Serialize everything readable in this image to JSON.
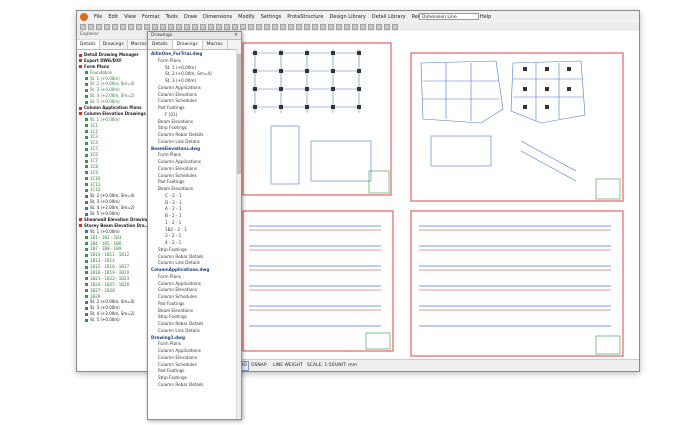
{
  "menu": [
    "File",
    "Edit",
    "View",
    "Format",
    "Tools",
    "Draw",
    "Dimensions",
    "Modify",
    "Settings",
    "ProtaStructure",
    "Design Library",
    "Detail Library",
    "Reinforcement",
    "Window",
    "Help"
  ],
  "combo_value": "Dimension Line",
  "left_panel": {
    "title": "Explorer",
    "tabs": [
      "Details",
      "Drawings",
      "Macros"
    ],
    "tree": [
      {
        "label": "Detail Drawing Manager",
        "style": "red bold"
      },
      {
        "label": "Export DWG/DXF",
        "style": "red bold"
      },
      {
        "label": "Form Plans",
        "style": "red bold"
      },
      {
        "label": "Foundation",
        "style": "green"
      },
      {
        "label": "St. 1 (+0.00m)",
        "style": "green"
      },
      {
        "label": "St. 2 (+0.00m, Sm=4)",
        "style": "green"
      },
      {
        "label": "St. 3 (+0.00m)",
        "style": "green"
      },
      {
        "label": "St. 4 (+2.00m, Sm=2)",
        "style": "green"
      },
      {
        "label": "St. 5 (+0.00m)",
        "style": "green"
      },
      {
        "label": "Column Application Plans",
        "style": "red bold"
      },
      {
        "label": "Column Elevation Drawings",
        "style": "red bold"
      },
      {
        "label": "St. 1 (+0.00m)",
        "style": "green"
      },
      {
        "label": "1C1",
        "style": "green"
      },
      {
        "label": "1C2",
        "style": "green"
      },
      {
        "label": "1C3",
        "style": "green"
      },
      {
        "label": "1C4",
        "style": "green"
      },
      {
        "label": "1C5",
        "style": "green"
      },
      {
        "label": "1C6",
        "style": "green"
      },
      {
        "label": "1C7",
        "style": "green"
      },
      {
        "label": "1C8",
        "style": "green"
      },
      {
        "label": "1C9",
        "style": "green"
      },
      {
        "label": "1C10",
        "style": "green"
      },
      {
        "label": "1C11",
        "style": "green"
      },
      {
        "label": "1C12",
        "style": "green"
      },
      {
        "label": "St. 2 (+0.00m, Sm=4)",
        "style": ""
      },
      {
        "label": "St. 3 (+0.00m)",
        "style": ""
      },
      {
        "label": "St. 4 (+2.00m, Sm=2)",
        "style": ""
      },
      {
        "label": "St. 5 (+0.00m)",
        "style": ""
      },
      {
        "label": "Shearwall Elevation Drawings",
        "style": "red bold"
      },
      {
        "label": "Storey Beam Elevation Dra...",
        "style": "red bold"
      },
      {
        "label": "St. 1 (+0.00m)",
        "style": ""
      },
      {
        "label": "1B1 - 1B2 - 1B3",
        "style": "green"
      },
      {
        "label": "1B4 - 1B5 - 1B6",
        "style": "green"
      },
      {
        "label": "1B7 - 1B8 - 1B9",
        "style": "green"
      },
      {
        "label": "1B10 - 1B11 - 1B12",
        "style": "green"
      },
      {
        "label": "1B13 - 1B14",
        "style": "green"
      },
      {
        "label": "1B15 - 1B16 - 1B17",
        "style": "green"
      },
      {
        "label": "1B18 - 1B19 - 1B20",
        "style": "green"
      },
      {
        "label": "1B21 - 1B22 - 1B23",
        "style": "green"
      },
      {
        "label": "1B24 - 1B25 - 1B26",
        "style": "green"
      },
      {
        "label": "1B27 - 1B28",
        "style": "green"
      },
      {
        "label": "1B29",
        "style": "green"
      },
      {
        "label": "St. 2 (+0.00m, Sm=4)",
        "style": ""
      },
      {
        "label": "St. 3 (+0.00m)",
        "style": ""
      },
      {
        "label": "St. 4 (+2.00m, Sm=2)",
        "style": ""
      },
      {
        "label": "St. 5 (+0.00m)",
        "style": ""
      }
    ]
  },
  "float_panel": {
    "title": "Drawings",
    "close": "×",
    "tabs": [
      "Details",
      "Drawings",
      "Macros"
    ],
    "items": [
      {
        "label": "AllInOne_ForTrial.dwg",
        "kind": "file",
        "indent": 0
      },
      {
        "label": "Form Plans",
        "kind": "",
        "indent": 1
      },
      {
        "label": "St. 1 (+0.00m)",
        "kind": "",
        "indent": 2
      },
      {
        "label": "St. 2 (+0.00m, Sm=4)",
        "kind": "",
        "indent": 2
      },
      {
        "label": "St. 3 (+0.00m)",
        "kind": "",
        "indent": 2
      },
      {
        "label": "Column Applications",
        "kind": "",
        "indent": 1
      },
      {
        "label": "Column Elevations",
        "kind": "",
        "indent": 1
      },
      {
        "label": "Column Schedules",
        "kind": "",
        "indent": 1
      },
      {
        "label": "Pad Footings",
        "kind": "",
        "indent": 1
      },
      {
        "label": "F (01)",
        "kind": "",
        "indent": 2
      },
      {
        "label": "Beam Elevations",
        "kind": "",
        "indent": 1
      },
      {
        "label": "Strip Footings",
        "kind": "",
        "indent": 1
      },
      {
        "label": "Column Rebar Details",
        "kind": "",
        "indent": 1
      },
      {
        "label": "Column Link Details",
        "kind": "",
        "indent": 1
      },
      {
        "label": "BeamElevations.dwg",
        "kind": "file",
        "indent": 0
      },
      {
        "label": "Form Plans",
        "kind": "",
        "indent": 1
      },
      {
        "label": "Column Applications",
        "kind": "",
        "indent": 1
      },
      {
        "label": "Column Elevations",
        "kind": "",
        "indent": 1
      },
      {
        "label": "Column Schedules",
        "kind": "",
        "indent": 1
      },
      {
        "label": "Pad Footings",
        "kind": "",
        "indent": 1
      },
      {
        "label": "Beam Elevations",
        "kind": "",
        "indent": 1
      },
      {
        "label": "C - 2 - 1",
        "kind": "",
        "indent": 2
      },
      {
        "label": "D - 2 - 1",
        "kind": "",
        "indent": 2
      },
      {
        "label": "A - 2 - 1",
        "kind": "",
        "indent": 2
      },
      {
        "label": "B - 2 - 1",
        "kind": "",
        "indent": 2
      },
      {
        "label": "1 - 2 - 1",
        "kind": "",
        "indent": 2
      },
      {
        "label": "1B2 - 2 - 1",
        "kind": "",
        "indent": 2
      },
      {
        "label": "3 - 2 - 1",
        "kind": "",
        "indent": 2
      },
      {
        "label": "4 - 2 - 1",
        "kind": "",
        "indent": 2
      },
      {
        "label": "Strip Footings",
        "kind": "",
        "indent": 1
      },
      {
        "label": "Column Rebar Details",
        "kind": "",
        "indent": 1
      },
      {
        "label": "Column Link Details",
        "kind": "",
        "indent": 1
      },
      {
        "label": "ColumnApplications.dwg",
        "kind": "file",
        "indent": 0
      },
      {
        "label": "Form Plans",
        "kind": "",
        "indent": 1
      },
      {
        "label": "Column Applications",
        "kind": "",
        "indent": 1
      },
      {
        "label": "Column Elevations",
        "kind": "",
        "indent": 1
      },
      {
        "label": "Column Schedules",
        "kind": "",
        "indent": 1
      },
      {
        "label": "Pad Footings",
        "kind": "",
        "indent": 1
      },
      {
        "label": "Beam Elevations",
        "kind": "",
        "indent": 1
      },
      {
        "label": "Strip Footings",
        "kind": "",
        "indent": 1
      },
      {
        "label": "Column Rebar Details",
        "kind": "",
        "indent": 1
      },
      {
        "label": "Column Link Details",
        "kind": "",
        "indent": 1
      },
      {
        "label": "Drawing1.dwg",
        "kind": "file",
        "indent": 0
      },
      {
        "label": "Form Plans",
        "kind": "",
        "indent": 1
      },
      {
        "label": "Column Applications",
        "kind": "",
        "indent": 1
      },
      {
        "label": "Column Elevations",
        "kind": "",
        "indent": 1
      },
      {
        "label": "Column Schedules",
        "kind": "",
        "indent": 1
      },
      {
        "label": "Pad Footings",
        "kind": "",
        "indent": 1
      },
      {
        "label": "Strip Footings",
        "kind": "",
        "indent": 1
      },
      {
        "label": "Column Rebar Details",
        "kind": "",
        "indent": 1
      }
    ]
  },
  "status": {
    "coords": "0.0000, 0.0000",
    "toggles": [
      "POLAR",
      "ORTHO",
      "OSNAP",
      "LINE WEIGHT",
      "SCALE: 1:50",
      "UNIT: mm"
    ]
  },
  "colors": {
    "sheet_border": "#e04444",
    "accent": "#e06a1c"
  }
}
